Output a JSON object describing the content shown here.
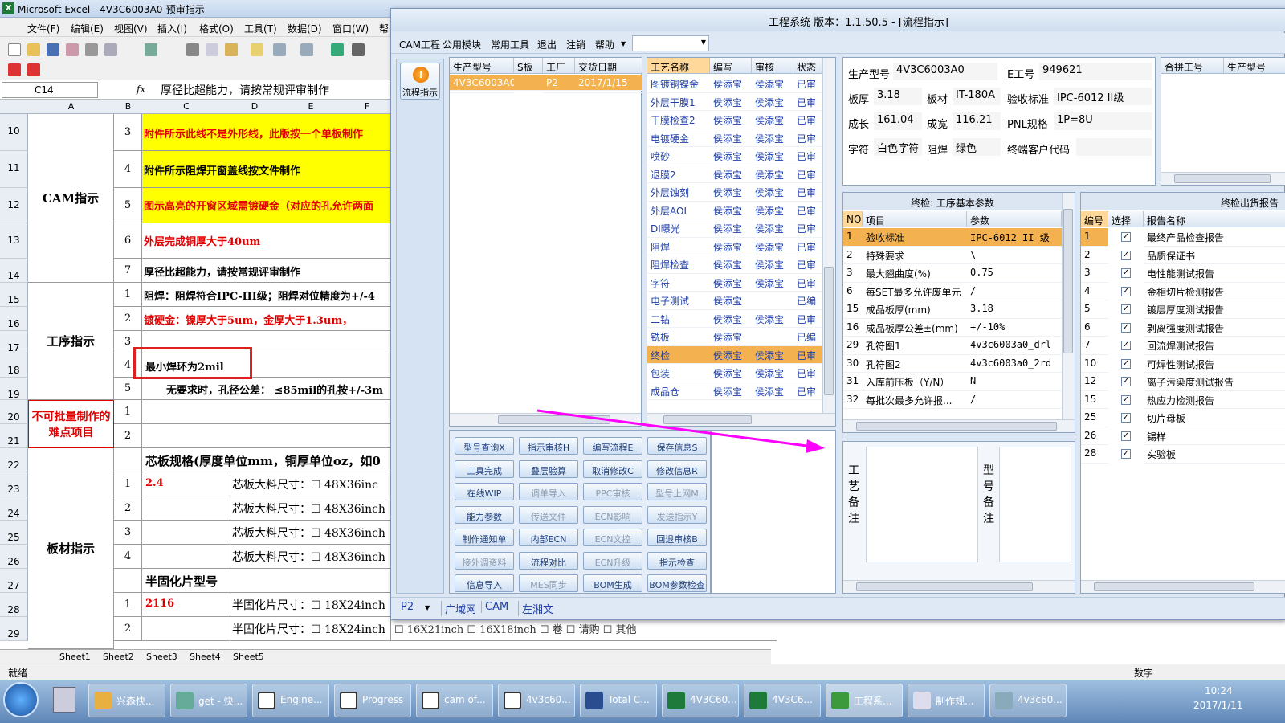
{
  "excel": {
    "title": "Microsoft Excel - 4V3C6003A0-预审指示",
    "menu": [
      "文件(F)",
      "编辑(E)",
      "视图(V)",
      "插入(I)",
      "格式(O)",
      "工具(T)",
      "数据(D)",
      "窗口(W)",
      "帮"
    ],
    "namebox": "C14",
    "fx": "fx",
    "formula": "厚径比超能力，请按常规评审制作",
    "columns": [
      "A",
      "B",
      "C",
      "D",
      "E",
      "F"
    ],
    "rows": [
      "10",
      "11",
      "12",
      "13",
      "14",
      "15",
      "16",
      "17",
      "18",
      "19",
      "20",
      "21",
      "22",
      "23",
      "24",
      "25",
      "26",
      "27",
      "28",
      "29"
    ],
    "groups": {
      "cam": "CAM指示",
      "proc": "工序指示",
      "hard": "不可批量制作的难点项目",
      "mat": "板材指示"
    },
    "cam_items": [
      {
        "n": "3",
        "t": "附件所示此线不是外形线，此版按一个单板制作"
      },
      {
        "n": "4",
        "t": "附件所示阻焊开窗盖线按文件制作"
      },
      {
        "n": "5",
        "t": "图示高亮的开窗区域需镀硬金（对应的孔允许两面"
      },
      {
        "n": "6",
        "t": "外层完成铜厚大于40um"
      },
      {
        "n": "7",
        "t": "厚径比超能力，请按常规评审制作"
      }
    ],
    "proc_items": [
      {
        "n": "1",
        "t": "阻焊：阻焊符合IPC-III级；阻焊对位精度为+/-4"
      },
      {
        "n": "2",
        "t": "镀硬金：镍厚大于5um，金厚大于1.3um，"
      },
      {
        "n": "3",
        "t": ""
      },
      {
        "n": "4",
        "t": "最小焊环为2mil"
      },
      {
        "n": "5",
        "t": "无要求时，孔径公差： ≤85mil的孔按+/-3m"
      }
    ],
    "hard_items": [
      "1",
      "2"
    ],
    "core_header": "芯板规格(厚度单位mm，铜厚单位oz，如0",
    "core_rows": [
      {
        "n": "1",
        "v": "2.4",
        "t": "芯板大料尺寸：☐ 48X36inc"
      },
      {
        "n": "2",
        "v": "",
        "t": "芯板大料尺寸：☐ 48X36inch"
      },
      {
        "n": "3",
        "v": "",
        "t": "芯板大料尺寸：☐ 48X36inch"
      },
      {
        "n": "4",
        "v": "",
        "t": "芯板大料尺寸：☐ 48X36inch"
      }
    ],
    "pp_header": "半固化片型号",
    "pp_rows": [
      {
        "n": "1",
        "v": "2116",
        "t": "半固化片尺寸：☐ 18X24inch"
      },
      {
        "n": "2",
        "v": "",
        "t": "半固化片尺寸：☐ 18X24inch"
      }
    ],
    "hidden_row": "☐ 16X21inch  ☐ 16X18inch  ☐ 卷    ☐ 请购    ☐ 其他",
    "sheets": [
      "Sheet1",
      "Sheet2",
      "Sheet3",
      "Sheet4",
      "Sheet5"
    ],
    "status_left": "就绪",
    "status_right": "数字"
  },
  "app": {
    "title": "工程系统  版本：1.1.50.5 - [流程指示]",
    "menu": [
      "CAM工程",
      "公用模块",
      "常用工具",
      "退出",
      "注销",
      "帮助"
    ],
    "nav_button": "流程指示",
    "orders": {
      "headers": [
        "生产型号",
        "S板",
        "工厂",
        "交货日期"
      ],
      "rows": [
        {
          "model": "4V3C6003A0",
          "s": "",
          "factory": "P2",
          "date": "2017/1/15"
        }
      ]
    },
    "process": {
      "headers": [
        "工艺名称",
        "编写",
        "审核",
        "状态"
      ],
      "rows": [
        {
          "name": "图镀铜镍金",
          "w": "侯添宝",
          "r": "侯添宝",
          "s": "已审"
        },
        {
          "name": "外层干膜1",
          "w": "侯添宝",
          "r": "侯添宝",
          "s": "已审"
        },
        {
          "name": "干膜检查2",
          "w": "侯添宝",
          "r": "侯添宝",
          "s": "已审"
        },
        {
          "name": "电镀硬金",
          "w": "侯添宝",
          "r": "侯添宝",
          "s": "已审"
        },
        {
          "name": "喷砂",
          "w": "侯添宝",
          "r": "侯添宝",
          "s": "已审"
        },
        {
          "name": "退膜2",
          "w": "侯添宝",
          "r": "侯添宝",
          "s": "已审"
        },
        {
          "name": "外层蚀刻",
          "w": "侯添宝",
          "r": "侯添宝",
          "s": "已审"
        },
        {
          "name": "外层AOI",
          "w": "侯添宝",
          "r": "侯添宝",
          "s": "已审"
        },
        {
          "name": "DI曝光",
          "w": "侯添宝",
          "r": "侯添宝",
          "s": "已审"
        },
        {
          "name": "阻焊",
          "w": "侯添宝",
          "r": "侯添宝",
          "s": "已审"
        },
        {
          "name": "阻焊检查",
          "w": "侯添宝",
          "r": "侯添宝",
          "s": "已审"
        },
        {
          "name": "字符",
          "w": "侯添宝",
          "r": "侯添宝",
          "s": "已审"
        },
        {
          "name": "电子测试",
          "w": "侯添宝",
          "r": "",
          "s": "已编"
        },
        {
          "name": "二钻",
          "w": "侯添宝",
          "r": "侯添宝",
          "s": "已审"
        },
        {
          "name": "铣板",
          "w": "侯添宝",
          "r": "",
          "s": "已编"
        },
        {
          "name": "终检",
          "w": "侯添宝",
          "r": "侯添宝",
          "s": "已审"
        },
        {
          "name": "包装",
          "w": "侯添宝",
          "r": "侯添宝",
          "s": "已审"
        },
        {
          "name": "成品仓",
          "w": "侯添宝",
          "r": "侯添宝",
          "s": "已审"
        }
      ]
    },
    "buttons": [
      [
        "型号查询X",
        "指示审核H",
        "编写流程E",
        "保存信息S"
      ],
      [
        "工具完成",
        "叠层验算",
        "取消修改C",
        "修改信息R"
      ],
      [
        "在线WIP",
        "调单导入",
        "PPC审核",
        "型号上网M"
      ],
      [
        "能力参数",
        "传送文件",
        "ECN影响",
        "发送指示Y"
      ],
      [
        "制作通知单",
        "内部ECN",
        "ECN文控",
        "回退审核B"
      ],
      [
        "接外调资料",
        "流程对比",
        "ECN升级",
        "指示检查"
      ],
      [
        "信息导入",
        "MES同步",
        "BOM生成",
        "BOM参数检查"
      ]
    ],
    "disabled_buttons": [
      "调单导入",
      "PPC审核",
      "型号上网M",
      "传送文件",
      "ECN影响",
      "发送指示Y",
      "ECN文控",
      "接外调资料",
      "ECN升级",
      "MES同步"
    ],
    "info": {
      "model_label": "生产型号",
      "model": "4V3C6003A0",
      "e_label": "E工号",
      "e": "949621",
      "thick_label": "板厚",
      "thick": "3.18",
      "mat_label": "板材",
      "mat": "IT-180A",
      "std_label": "验收标准",
      "std": "IPC-6012 II级",
      "len_label": "成长",
      "len": "161.04",
      "wid_label": "成宽",
      "wid": "116.21",
      "pnl_label": "PNL规格",
      "pnl": "1P=8U",
      "char_label": "字符",
      "char": "白色字符",
      "mask_label": "阻焊",
      "mask": "绿色",
      "cust_label": "终端客户代码",
      "cust": ""
    },
    "merge": {
      "headers": [
        "合拼工号",
        "生产型号"
      ]
    },
    "params": {
      "title": "终检: 工序基本参数",
      "headers": [
        "NO",
        "项目",
        "参数"
      ],
      "rows": [
        {
          "no": "1",
          "item": "验收标准",
          "val": "IPC-6012 II 级"
        },
        {
          "no": "2",
          "item": "特殊要求",
          "val": "\\"
        },
        {
          "no": "3",
          "item": "最大翘曲度(%)",
          "val": "0.75"
        },
        {
          "no": "6",
          "item": "每SET最多允许废单元",
          "val": "/"
        },
        {
          "no": "15",
          "item": "成品板厚(mm)",
          "val": "3.18"
        },
        {
          "no": "16",
          "item": "成品板厚公差±(mm)",
          "val": "+/-10%"
        },
        {
          "no": "29",
          "item": "孔符图1",
          "val": "4v3c6003a0_drl"
        },
        {
          "no": "30",
          "item": "孔符图2",
          "val": "4v3c6003a0_2rd"
        },
        {
          "no": "31",
          "item": "入库前压板（Y/N）",
          "val": "N"
        },
        {
          "no": "32",
          "item": "每批次最多允许报...",
          "val": "/"
        }
      ]
    },
    "reports": {
      "title": "终检出货报告",
      "headers": [
        "编号",
        "选择",
        "报告名称"
      ],
      "rows": [
        {
          "no": "1",
          "name": "最终产品检查报告"
        },
        {
          "no": "2",
          "name": "品质保证书"
        },
        {
          "no": "3",
          "name": "电性能测试报告"
        },
        {
          "no": "4",
          "name": "金相切片检测报告"
        },
        {
          "no": "5",
          "name": "镀层厚度测试报告"
        },
        {
          "no": "6",
          "name": "剥离强度测试报告"
        },
        {
          "no": "7",
          "name": "回流焊测试报告"
        },
        {
          "no": "10",
          "name": "可焊性测试报告"
        },
        {
          "no": "12",
          "name": "离子污染度测试报告"
        },
        {
          "no": "15",
          "name": "热应力检测报告"
        },
        {
          "no": "25",
          "name": "切片母板"
        },
        {
          "no": "26",
          "name": "锡样"
        },
        {
          "no": "28",
          "name": "实验板"
        }
      ]
    },
    "remark_proc": "工艺备注",
    "remark_model": "型号备注",
    "status_tabs": [
      "P2",
      "广域网",
      "CAM",
      "左湘文"
    ]
  },
  "taskbar": {
    "items": [
      "兴森快...",
      "get - 快...",
      "Engine...",
      "Progress",
      "cam of...",
      "4v3c60...",
      "Total C...",
      "4V3C60...",
      "4V3C6...",
      "工程系...",
      "制作规...",
      "4v3c60..."
    ],
    "time": "10:24",
    "date": "2017/1/11"
  },
  "colors": {
    "highlight": "#ffff00",
    "red_text": "#e00000",
    "annotation": "#ff00ff",
    "callout": "#e02020",
    "selected": "#f3b24f"
  }
}
